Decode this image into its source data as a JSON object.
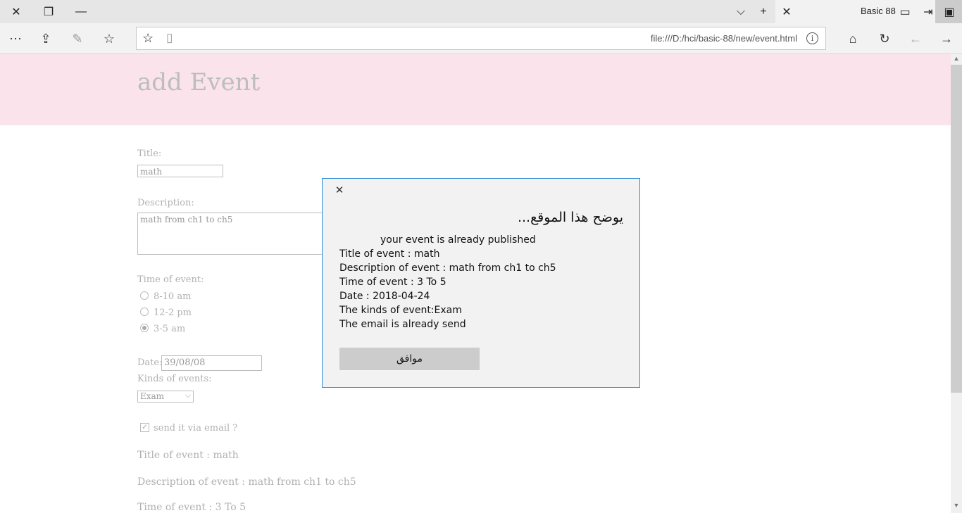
{
  "browser": {
    "tab_title": "Basic 88",
    "url": "file:///D:/hci/basic-88/new/event.html",
    "info_glyph": "i"
  },
  "page": {
    "title": "add Event",
    "form": {
      "title_label": "Title:",
      "title_value": "math",
      "description_label": "Description:",
      "description_value": "math from ch1 to ch5",
      "time_label": "Time of event:",
      "time_options": [
        "8-10 am",
        "12-2 pm",
        "3-5 am"
      ],
      "selected_time_index": 2,
      "date_label": "Date:",
      "date_value": "39/08/08",
      "kinds_label": "Kinds of events:",
      "kinds_value": "Exam",
      "email_label": "send it via email ?",
      "email_checked": true
    },
    "output": {
      "title_line": "Title of event : math",
      "description_line": "Description of event : math from ch1 to ch5",
      "time_line": "Time of event : 3 To 5"
    }
  },
  "dialog": {
    "heading": "يوضح هذا الموقع...",
    "lines": [
      "your event is already published",
      "Title of event : math",
      "Description of event : math from ch1 to ch5",
      "Time of event : 3 To 5",
      "Date : 2018-04-24",
      "The kinds of event:Exam",
      "The email is already send"
    ],
    "ok_label": "موافق",
    "accent_color": "#2b8ad6"
  },
  "colors": {
    "header_band": "#fae3ea",
    "titlebar": "#e6e6e6",
    "toolbar": "#f2f2f2"
  }
}
